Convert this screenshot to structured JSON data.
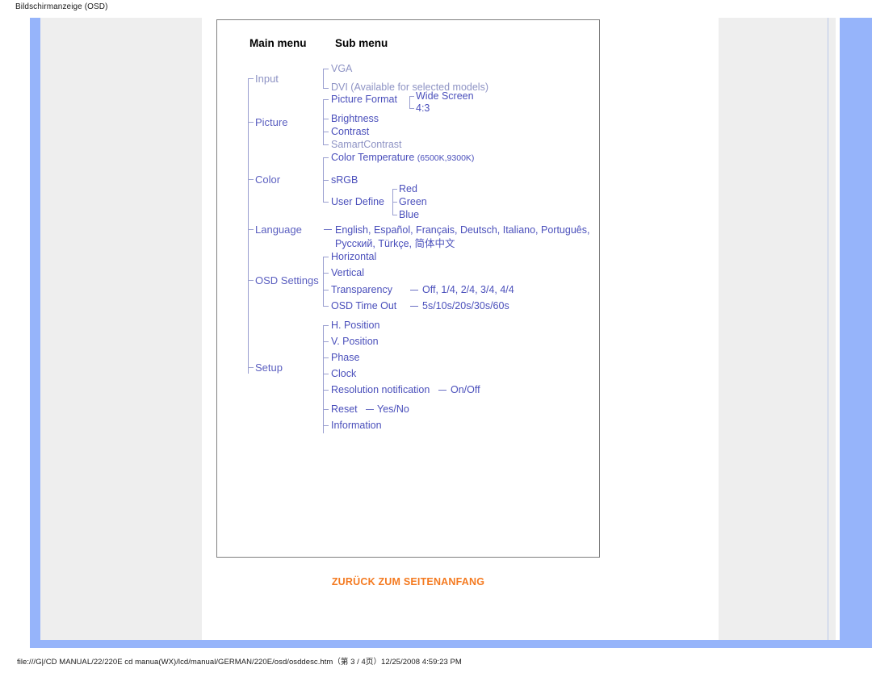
{
  "print": {
    "header_title": "Bildschirmanzeige (OSD)",
    "footer_path": "file:///G|/CD MANUAL/22/220E cd manua(WX)/lcd/manual/GERMAN/220E/osd/osddesc.htm（第 3 / 4页）12/25/2008 4:59:23 PM"
  },
  "diagram": {
    "col_main_header": "Main menu",
    "col_sub_header": "Sub menu",
    "groups": {
      "input": {
        "label": "Input",
        "items": [
          "VGA",
          "DVI (Available for selected models)"
        ]
      },
      "picture": {
        "label": "Picture",
        "picture_format": {
          "label": "Picture Format",
          "options": [
            "Wide Screen",
            "4:3"
          ]
        },
        "items": [
          "Brightness",
          "Contrast",
          "SamartContrast"
        ]
      },
      "color": {
        "label": "Color",
        "color_temperature": {
          "label": "Color Temperature",
          "values": "(6500K,9300K)"
        },
        "srgb": "sRGB",
        "user_define": {
          "label": "User Define",
          "channels": [
            "Red",
            "Green",
            "Blue"
          ]
        }
      },
      "language": {
        "label": "Language",
        "line1": "English, Español, Français, Deutsch, Italiano, Português,",
        "line2": "Русский, Türkçe, 简体中文"
      },
      "osd_settings": {
        "label": "OSD Settings",
        "items": [
          {
            "label": "Horizontal",
            "value": ""
          },
          {
            "label": "Vertical",
            "value": ""
          },
          {
            "label": "Transparency",
            "value": "Off, 1/4, 2/4, 3/4, 4/4"
          },
          {
            "label": "OSD Time Out",
            "value": "5s/10s/20s/30s/60s"
          }
        ]
      },
      "setup": {
        "label": "Setup",
        "items": [
          {
            "label": "H. Position",
            "value": ""
          },
          {
            "label": "V. Position",
            "value": ""
          },
          {
            "label": "Phase",
            "value": ""
          },
          {
            "label": "Clock",
            "value": ""
          },
          {
            "label": "Resolution notification",
            "value": "On/Off"
          },
          {
            "label": "Reset",
            "value": "Yes/No"
          },
          {
            "label": "Information",
            "value": ""
          }
        ]
      }
    }
  },
  "links": {
    "back_to_top": "ZURÜCK ZUM SEITENANFANG"
  },
  "colors": {
    "rail_blue": "#96b4fa",
    "canvas_gray": "#eeeeee",
    "accent_orange": "#f47a20",
    "tree_blue": "#5b5fc0"
  }
}
